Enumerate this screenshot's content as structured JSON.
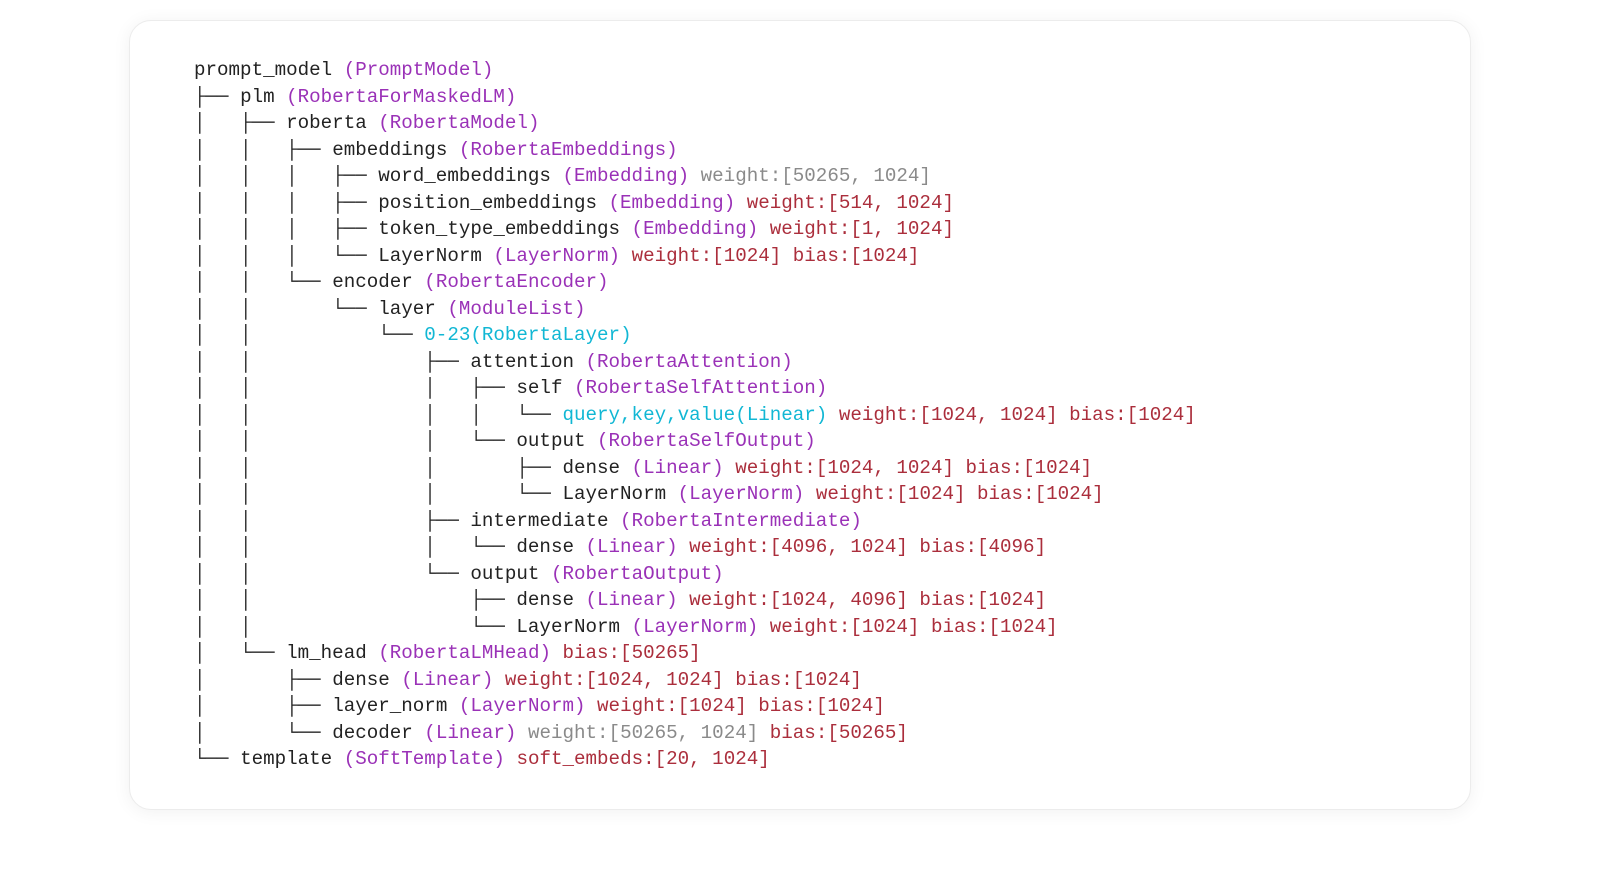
{
  "root": {
    "name": "prompt_model",
    "type": "PromptModel",
    "children": [
      "plm",
      "template"
    ]
  },
  "plm": {
    "name": "plm",
    "type": "RobertaForMaskedLM",
    "children": [
      "roberta",
      "lm_head"
    ]
  },
  "roberta": {
    "name": "roberta",
    "type": "RobertaModel",
    "children": [
      "embeddings",
      "encoder"
    ]
  },
  "embeddings": {
    "name": "embeddings",
    "type": "RobertaEmbeddings"
  },
  "emb_word": {
    "name": "word_embeddings",
    "type": "Embedding",
    "params_grey": "weight:[50265, 1024]"
  },
  "emb_pos": {
    "name": "position_embeddings",
    "type": "Embedding",
    "params": "weight:[514, 1024]"
  },
  "emb_tok": {
    "name": "token_type_embeddings",
    "type": "Embedding",
    "params": "weight:[1, 1024]"
  },
  "emb_ln": {
    "name": "LayerNorm",
    "type": "LayerNorm",
    "params": "weight:[1024] bias:[1024]"
  },
  "encoder": {
    "name": "encoder",
    "type": "RobertaEncoder"
  },
  "layer": {
    "name": "layer",
    "type": "ModuleList"
  },
  "layers_range": {
    "range": "0-23",
    "type": "RobertaLayer"
  },
  "attention": {
    "name": "attention",
    "type": "RobertaAttention"
  },
  "self": {
    "name": "self",
    "type": "RobertaSelfAttention"
  },
  "qkv": {
    "group": "query,key,value",
    "type": "Linear",
    "params": "weight:[1024, 1024] bias:[1024]"
  },
  "attn_out": {
    "name": "output",
    "type": "RobertaSelfOutput"
  },
  "attn_out_dense": {
    "name": "dense",
    "type": "Linear",
    "params": "weight:[1024, 1024] bias:[1024]"
  },
  "attn_out_ln": {
    "name": "LayerNorm",
    "type": "LayerNorm",
    "params": "weight:[1024] bias:[1024]"
  },
  "intermediate": {
    "name": "intermediate",
    "type": "RobertaIntermediate"
  },
  "intermediate_dense": {
    "name": "dense",
    "type": "Linear",
    "params": "weight:[4096, 1024] bias:[4096]"
  },
  "out": {
    "name": "output",
    "type": "RobertaOutput"
  },
  "out_dense": {
    "name": "dense",
    "type": "Linear",
    "params": "weight:[1024, 4096] bias:[1024]"
  },
  "out_ln": {
    "name": "LayerNorm",
    "type": "LayerNorm",
    "params": "weight:[1024] bias:[1024]"
  },
  "lm_head": {
    "name": "lm_head",
    "type": "RobertaLMHead",
    "params": "bias:[50265]"
  },
  "lm_dense": {
    "name": "dense",
    "type": "Linear",
    "params": "weight:[1024, 1024] bias:[1024]"
  },
  "lm_ln": {
    "name": "layer_norm",
    "type": "LayerNorm",
    "params": "weight:[1024] bias:[1024]"
  },
  "lm_dec": {
    "name": "decoder",
    "type": "Linear",
    "params_grey": "weight:[50265, 1024]",
    "params": "bias:[50265]"
  },
  "template": {
    "name": "template",
    "type": "SoftTemplate",
    "params": "soft_embeds:[20, 1024]"
  }
}
